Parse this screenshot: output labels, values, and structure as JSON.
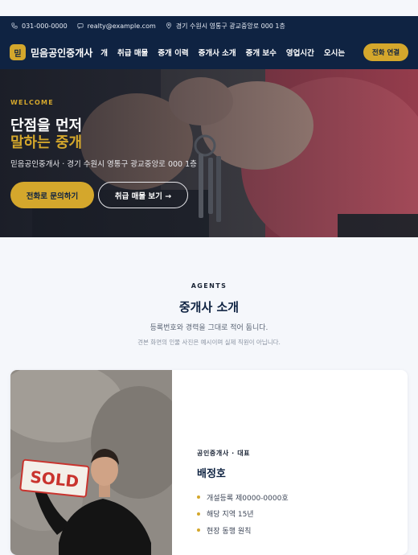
{
  "topbar": {
    "phone": "031-000-0000",
    "email": "realty@example.com",
    "address": "경기 수원시 영통구 광교중앙로 000 1층"
  },
  "nav": {
    "logo_badge": "믿",
    "logo_text": "믿음공인중개사",
    "menu": [
      "개",
      "취급 매물",
      "중개 이력",
      "중개사 소개",
      "중개 보수",
      "영업시간",
      "오시는"
    ],
    "call_button": "전화 연결"
  },
  "hero": {
    "eyebrow": "WELCOME",
    "title_line1": "단점을 먼저",
    "title_line2": "말하는 중개",
    "subtitle": "믿음공인중개사 · 경기 수원시 영통구 광교중앙로 000 1층",
    "primary_button": "전화로 문의하기",
    "secondary_button": "취급 매물 보기 →"
  },
  "agents": {
    "eyebrow": "AGENTS",
    "title": "중개사 소개",
    "subtitle": "등록번호와 경력을 그대로 적어 둡니다.",
    "note": "견본 화면의 인물 사진은 예시이며 실제 직원이 아닙니다.",
    "card": {
      "sign_text": "SOLD",
      "role": "공인중개사 · 대표",
      "name": "배정호",
      "facts": [
        "개설등록 제0000-0000호",
        "해당 지역 15년",
        "현장 동행 원칙"
      ]
    }
  },
  "colors": {
    "navy": "#0f2342",
    "gold": "#d4a72c",
    "background": "#f5f7fb"
  }
}
